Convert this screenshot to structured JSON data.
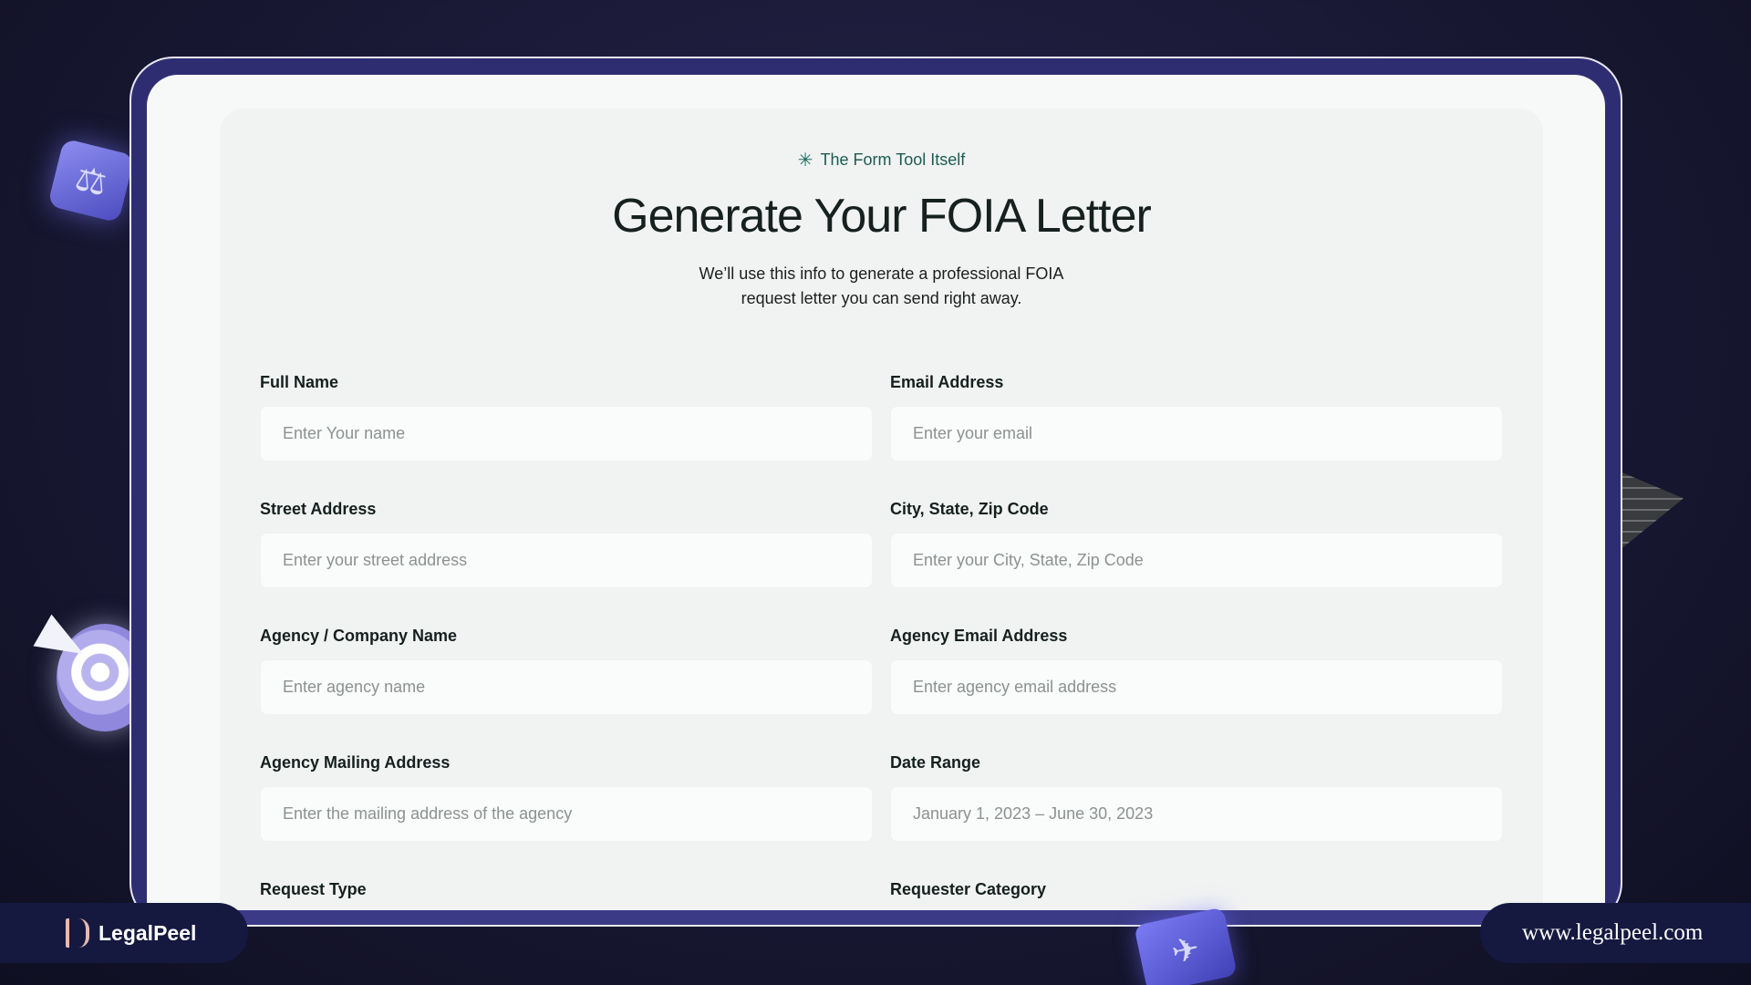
{
  "header": {
    "eyebrow_icon": "sparkle-icon",
    "eyebrow": "The Form Tool Itself",
    "title": "Generate Your FOIA Letter",
    "subtitle": "We’ll use this info to generate a professional FOIA request letter you can send right away."
  },
  "form": {
    "full_name": {
      "label": "Full Name",
      "placeholder": "Enter Your name"
    },
    "email": {
      "label": "Email Address",
      "placeholder": "Enter your email"
    },
    "street": {
      "label": "Street Address",
      "placeholder": "Enter your street address"
    },
    "city": {
      "label": "City, State, Zip Code",
      "placeholder": "Enter your City, State, Zip Code"
    },
    "agency_name": {
      "label": "Agency / Company Name",
      "placeholder": "Enter agency name"
    },
    "agency_email": {
      "label": "Agency Email Address",
      "placeholder": "Enter agency email address"
    },
    "agency_mailing": {
      "label": "Agency Mailing Address",
      "placeholder": "Enter the mailing address of the agency"
    },
    "date_range": {
      "label": "Date Range",
      "placeholder": "January 1, 2023 – June 30, 2023"
    },
    "request_type": {
      "label": "Request Type"
    },
    "requester_category": {
      "label": "Requester Category"
    }
  },
  "branding": {
    "name": "LegalPeel",
    "url": "www.legalpeel.com"
  },
  "colors": {
    "frame": "#2f2d72",
    "accent": "#1b5b52",
    "background": "#1b1a38"
  }
}
